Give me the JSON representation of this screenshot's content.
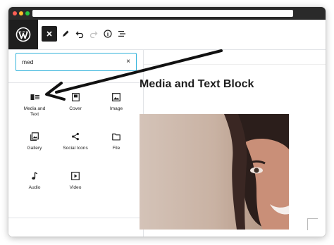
{
  "toolbar": {
    "logo_icon": "wordpress-logo",
    "buttons": [
      {
        "icon": "close-icon"
      },
      {
        "icon": "pencil-icon"
      },
      {
        "icon": "undo-icon"
      },
      {
        "icon": "redo-icon"
      },
      {
        "icon": "info-icon"
      },
      {
        "icon": "list-view-icon"
      }
    ]
  },
  "search": {
    "value": "med",
    "clear_glyph": "×"
  },
  "blocks": [
    {
      "label": "Media and Text",
      "icon": "media-text-icon"
    },
    {
      "label": "Cover",
      "icon": "cover-icon"
    },
    {
      "label": "Image",
      "icon": "image-icon"
    },
    {
      "label": "Gallery",
      "icon": "gallery-icon"
    },
    {
      "label": "Social Icons",
      "icon": "share-icon"
    },
    {
      "label": "File",
      "icon": "folder-icon"
    },
    {
      "label": "Audio",
      "icon": "music-note-icon"
    },
    {
      "label": "Video",
      "icon": "video-icon"
    }
  ],
  "content": {
    "heading": "Media and Text Block"
  },
  "colors": {
    "search_border": "#33b3db",
    "dark": "#1e1e1e",
    "titlebar": "#2a2a2a"
  }
}
